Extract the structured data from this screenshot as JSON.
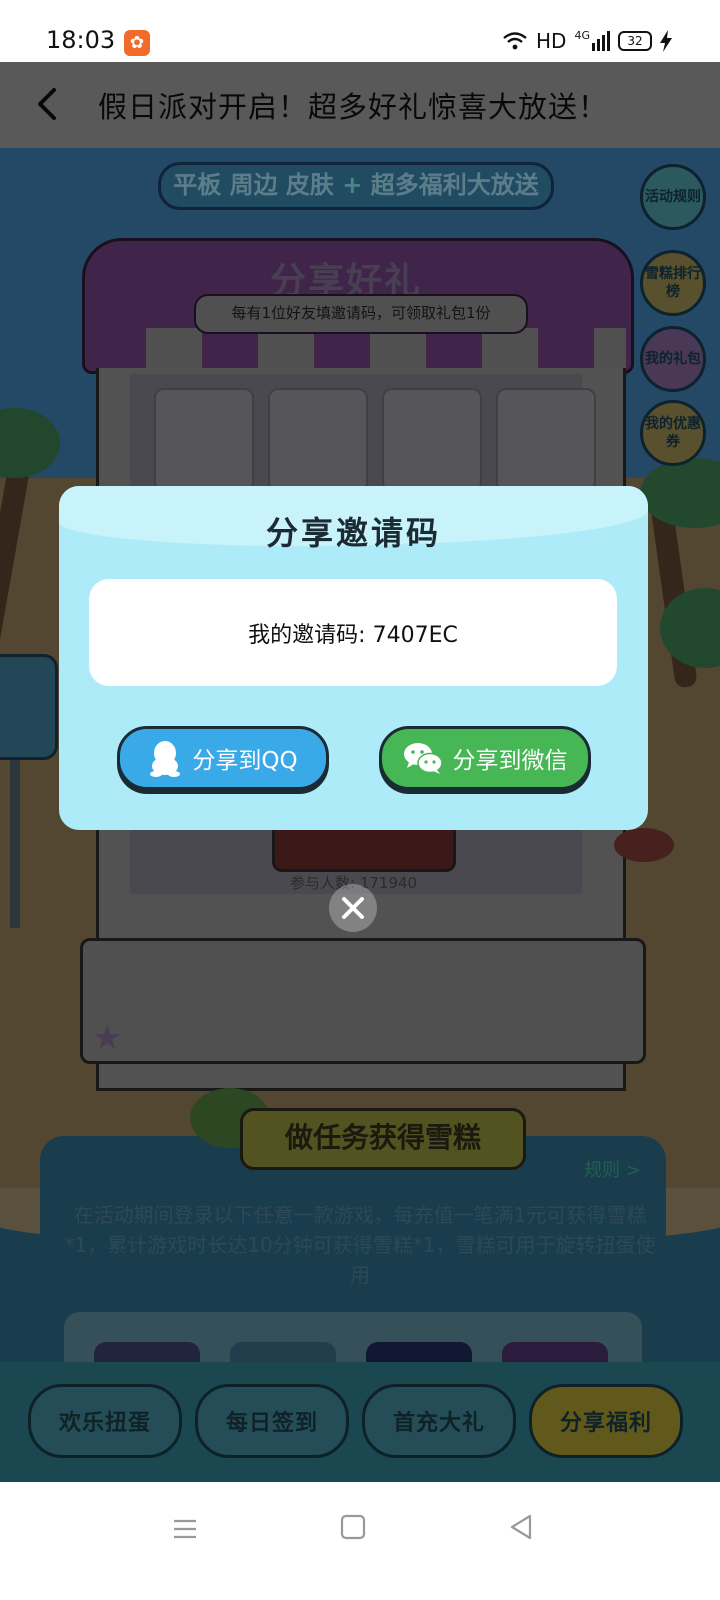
{
  "status_bar": {
    "time": "18:03",
    "network_label": "HD",
    "signal_label": "4G",
    "battery": "32"
  },
  "header": {
    "title": "假日派对开启！超多好礼惊喜大放送！"
  },
  "promo_banner": {
    "prefix": "平板 周边 皮肤",
    "plus": "+",
    "suffix": "超多福利大放送"
  },
  "side_buttons": {
    "rules": "活动规则",
    "ranking": "雪糕排行榜",
    "my_gifts": "我的礼包",
    "my_coupons": "我的优惠券"
  },
  "share_section": {
    "title": "分享好礼",
    "subtitle": "每有1位好友填邀请码，可领取礼包1份",
    "participants": "参与人数: 171940"
  },
  "tasks": {
    "title": "做任务获得雪糕",
    "rules_link": "规则 >",
    "description": "在活动期间登录以下任意一款游戏，每充值一笔满1元可获得雪糕*1，累计游戏时长达10分钟可获得雪糕*1，雪糕可用于旋转扭蛋使用"
  },
  "tabs": [
    {
      "label": "欢乐扭蛋"
    },
    {
      "label": "每日签到"
    },
    {
      "label": "首充大礼"
    },
    {
      "label": "分享福利"
    }
  ],
  "dialog": {
    "title": "分享邀请码",
    "invite_text": "我的邀请码: 7407EC",
    "share_qq": "分享到QQ",
    "share_wechat": "分享到微信"
  },
  "colors": {
    "qq_button": "#3aa9e8",
    "wechat_button": "#47b655",
    "dialog_bg": "#aeebf8"
  }
}
